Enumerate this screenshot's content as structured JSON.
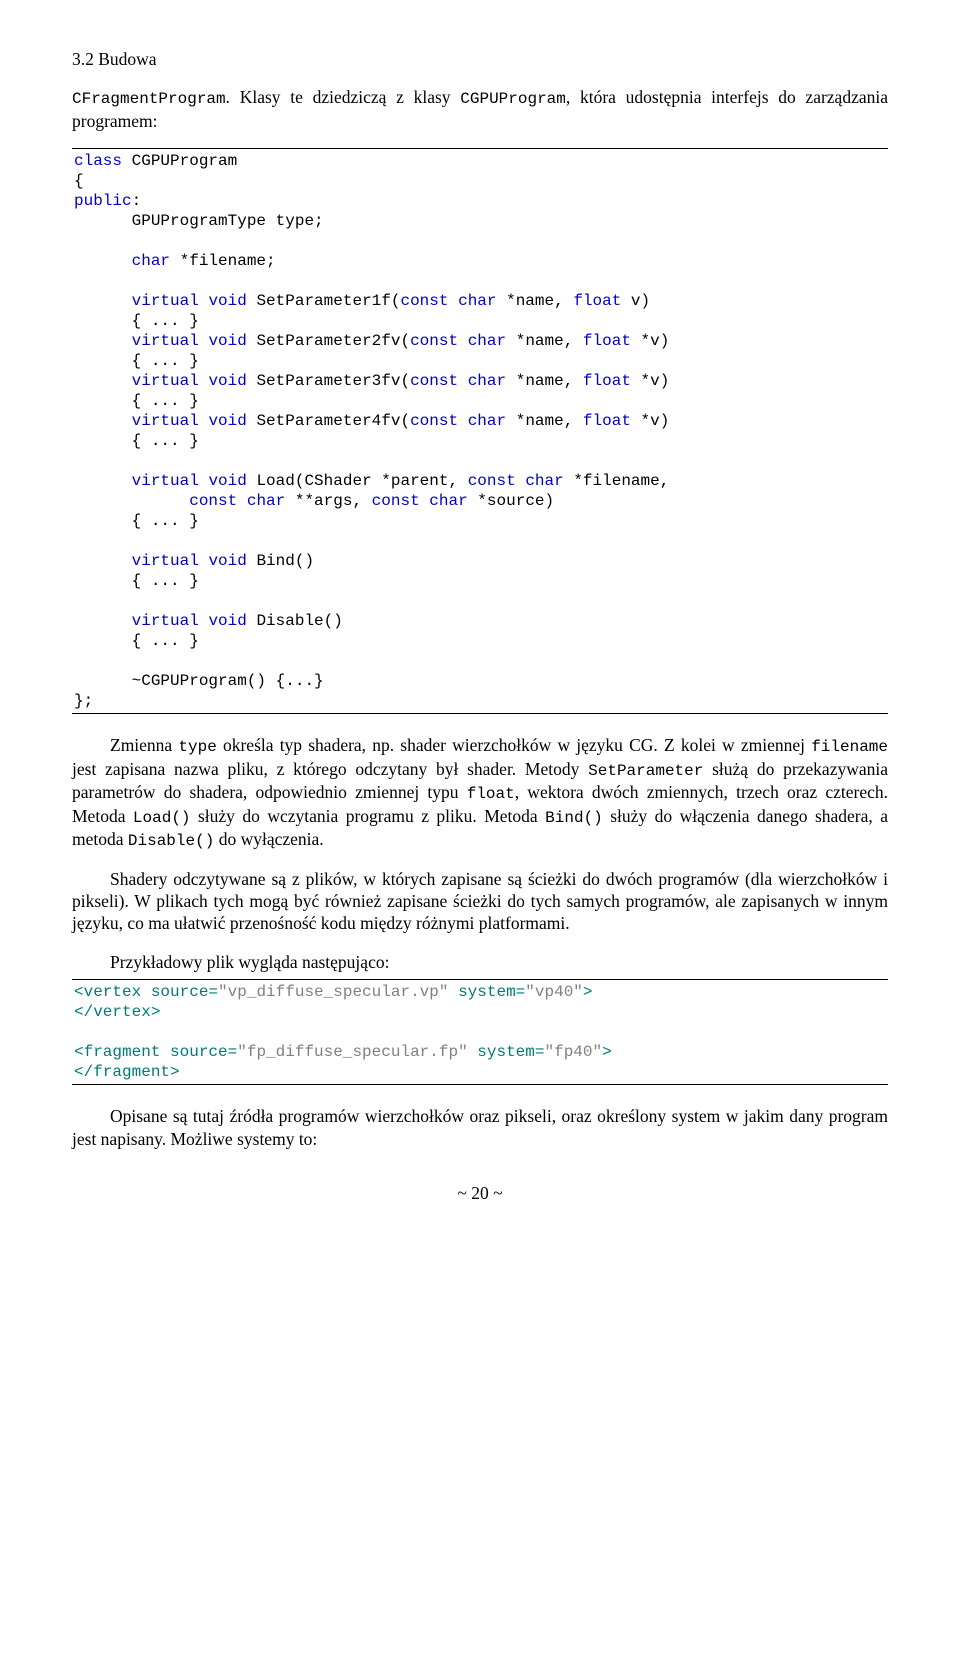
{
  "header": "3.2 Budowa",
  "intro_prefix": "CFragmentProgram",
  "intro_rest": ". Klasy te dziedziczą z klasy ",
  "intro_cg": "CGPUProgram",
  "intro_end": ", która udostępnia interfejs do zarządzania programem:",
  "code1": {
    "l1_a": "class",
    "l1_b": " CGPUProgram",
    "l2": "{",
    "l3_a": "public",
    "l3_b": ":",
    "l4_a": "GPUProgramType type;",
    "l5_a": "char",
    "l5_b": " *filename;",
    "l6_a": "virtual",
    "l6_b": " ",
    "l6_c": "void",
    "l6_d": " SetParameter1f(",
    "l6_e": "const",
    "l6_f": " ",
    "l6_g": "char",
    "l6_h": " *name, ",
    "l6_i": "float",
    "l6_j": " v)",
    "l7": "{ ... }",
    "l8_a": "virtual",
    "l8_b": " ",
    "l8_c": "void",
    "l8_d": " SetParameter2fv(",
    "l8_e": "const",
    "l8_f": " ",
    "l8_g": "char",
    "l8_h": " *name, ",
    "l8_i": "float",
    "l8_j": " *v)",
    "l9": "{ ... }",
    "l10_a": "virtual",
    "l10_b": " ",
    "l10_c": "void",
    "l10_d": " SetParameter3fv(",
    "l10_e": "const",
    "l10_f": " ",
    "l10_g": "char",
    "l10_h": " *name, ",
    "l10_i": "float",
    "l10_j": " *v)",
    "l11": "{ ... }",
    "l12_a": "virtual",
    "l12_b": " ",
    "l12_c": "void",
    "l12_d": " SetParameter4fv(",
    "l12_e": "const",
    "l12_f": " ",
    "l12_g": "char",
    "l12_h": " *name, ",
    "l12_i": "float",
    "l12_j": " *v)",
    "l13": "{ ... }",
    "l14_a": "virtual",
    "l14_b": " ",
    "l14_c": "void",
    "l14_d": " Load(CShader *parent, ",
    "l14_e": "const",
    "l14_f": " ",
    "l14_g": "char",
    "l14_h": " *filename,",
    "l15_a": "const",
    "l15_b": " ",
    "l15_c": "char",
    "l15_d": " **args, ",
    "l15_e": "const",
    "l15_f": " ",
    "l15_g": "char",
    "l15_h": " *source)",
    "l16": "{ ... }",
    "l17_a": "virtual",
    "l17_b": " ",
    "l17_c": "void",
    "l17_d": " Bind()",
    "l18": "{ ... }",
    "l19_a": "virtual",
    "l19_b": " ",
    "l19_c": "void",
    "l19_d": " Disable()",
    "l20": "{ ... }",
    "l21": "~CGPUProgram() {...}",
    "l22": "};"
  },
  "para1_a": "Zmienna ",
  "para1_b": "type",
  "para1_c": " określa typ shadera, np. shader wierzchołków w języku CG. Z kolei w zmiennej ",
  "para1_d": "filename",
  "para1_e": " jest zapisana nazwa pliku, z którego odczytany był shader. Metody ",
  "para1_f": "SetParameter",
  "para1_g": " służą do przekazywania parametrów do shadera, odpowiednio zmiennej typu ",
  "para1_h": "float",
  "para1_i": ", wektora dwóch zmiennych, trzech oraz czterech. Metoda ",
  "para1_j": "Load()",
  "para1_k": " służy do wczytania programu z pliku. Metoda ",
  "para1_l": "Bind()",
  "para1_m": " służy do włączenia danego shadera, a metoda ",
  "para1_n": "Disable()",
  "para1_o": " do wyłączenia.",
  "para2": "Shadery odczytywane są z plików, w których zapisane są ścieżki do dwóch programów (dla wierzchołków i pikseli). W plikach tych mogą być również zapisane ścieżki do tych samych programów, ale zapisanych w innym języku, co ma ułatwić przenośność kodu między różnymi platformami.",
  "para3": "Przykładowy plik wygląda następująco:",
  "code2": {
    "l1_a": "<vertex source=",
    "l1_b": "\"vp_diffuse_specular.vp\"",
    "l1_c": " system=",
    "l1_d": "\"vp40\"",
    "l1_e": ">",
    "l2": "</vertex>",
    "l3_a": "<fragment source=",
    "l3_b": "\"fp_diffuse_specular.fp\"",
    "l3_c": " system=",
    "l3_d": "\"fp40\"",
    "l3_e": ">",
    "l4": "</fragment>"
  },
  "para4": "Opisane są tutaj źródła programów wierzchołków oraz pikseli, oraz określony system w jakim dany program jest napisany. Możliwe systemy to:",
  "page_number": "~ 20 ~"
}
